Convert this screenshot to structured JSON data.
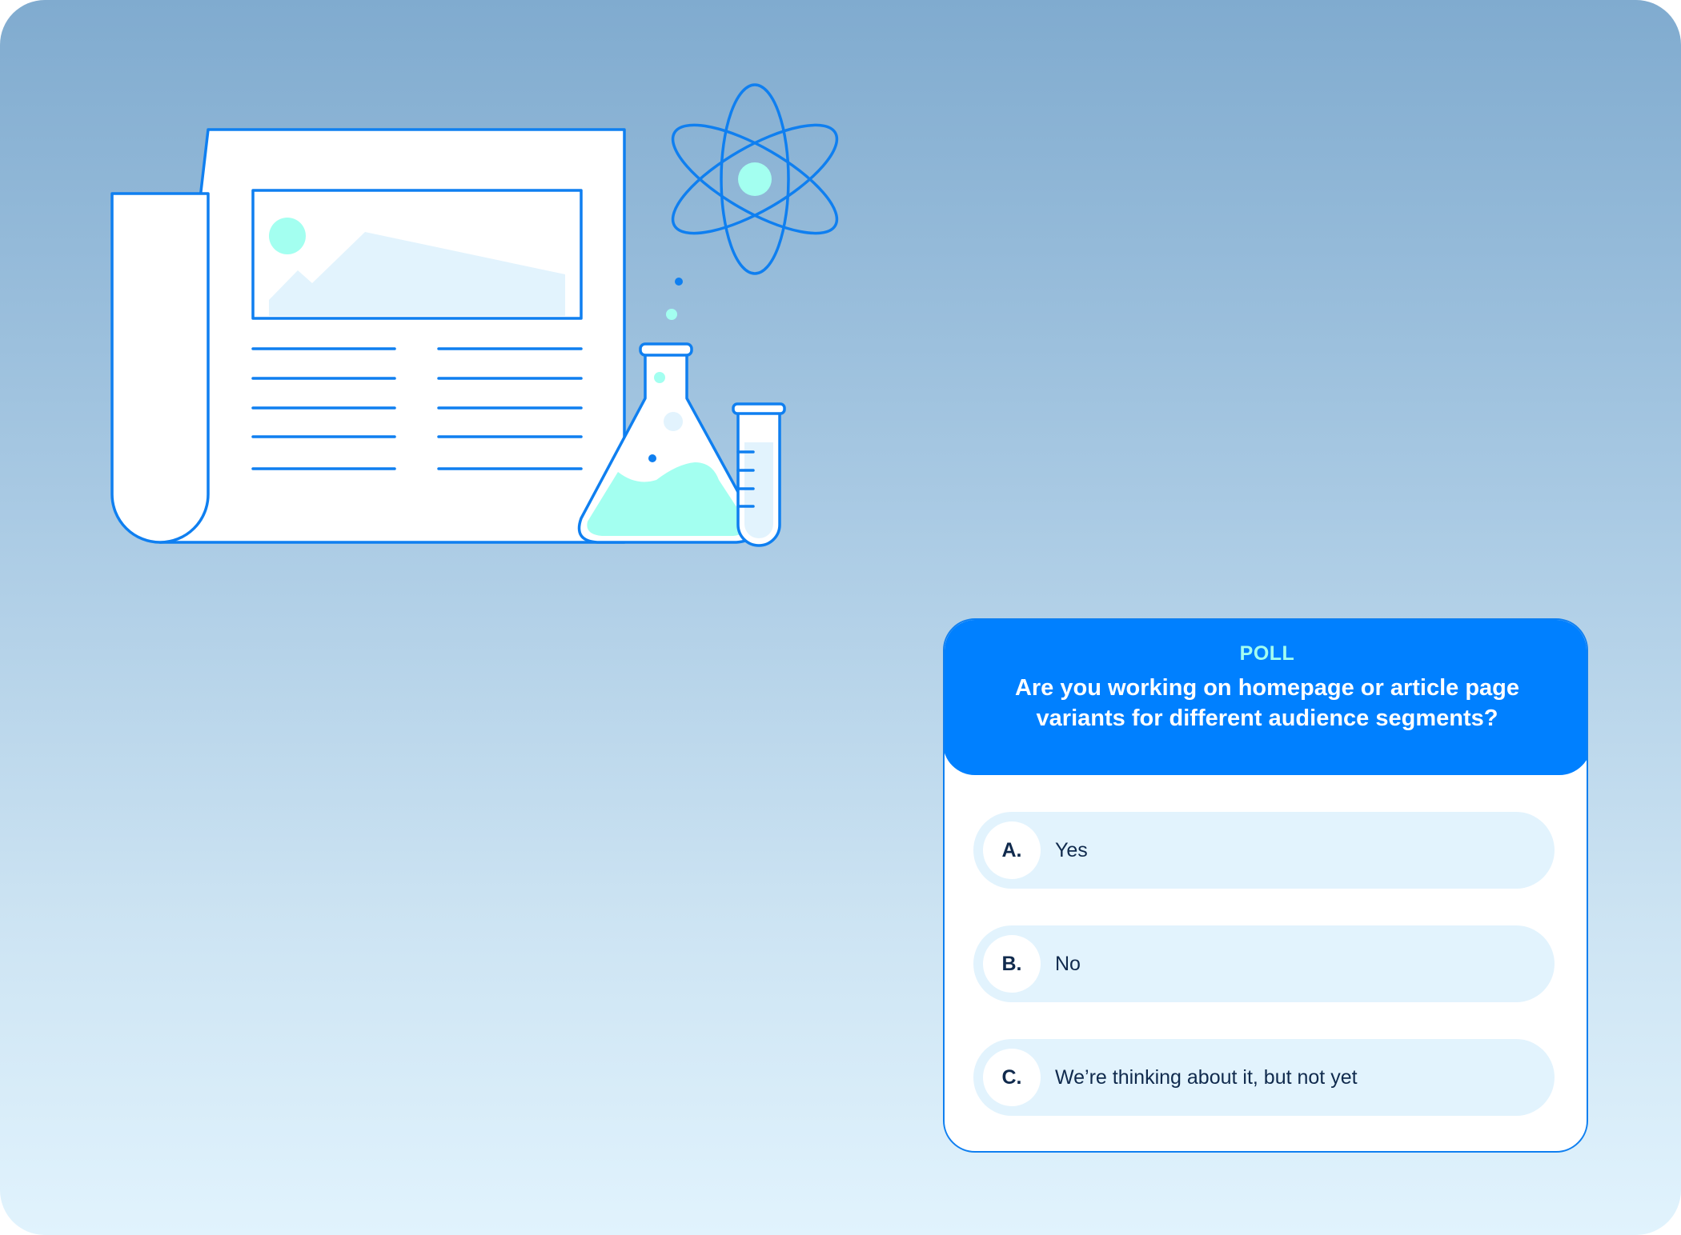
{
  "poll": {
    "tag": "POLL",
    "question": "Are you working on homepage or article page variants for different audience segments?",
    "options": [
      {
        "letter": "A.",
        "text": "Yes"
      },
      {
        "letter": "B.",
        "text": "No"
      },
      {
        "letter": "C.",
        "text": "We’re thinking about it, but not yet"
      }
    ]
  },
  "colors": {
    "accent": "#0080ff",
    "outline": "#0f7ff0",
    "mint": "#a3fff0",
    "option_bg": "#e2f3fd",
    "text_dark": "#102a4d"
  },
  "icons": [
    "newspaper-icon",
    "image-placeholder-icon",
    "flask-icon",
    "test-tube-icon",
    "atom-icon"
  ]
}
